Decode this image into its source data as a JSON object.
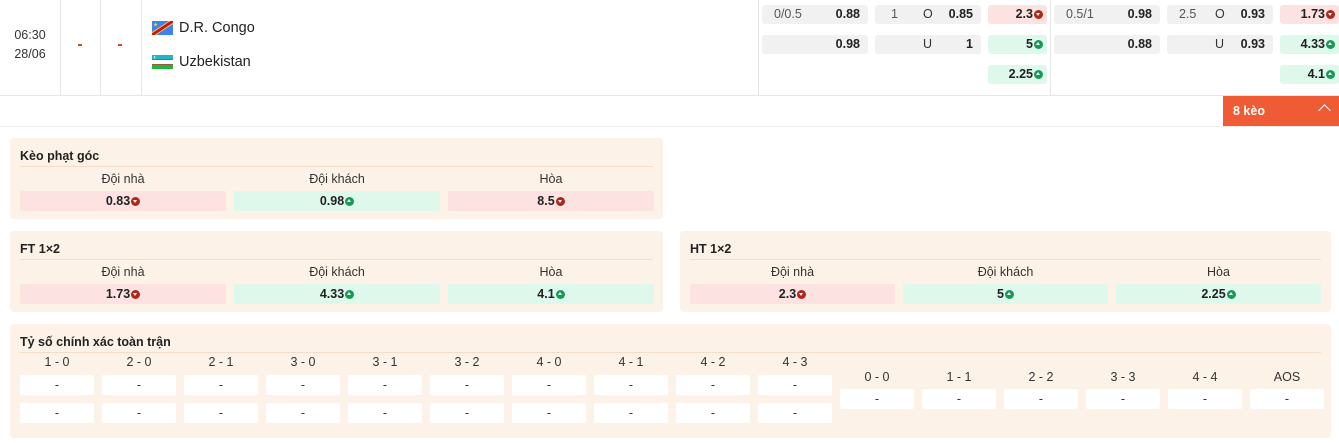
{
  "match": {
    "time": "06:30",
    "date": "28/06",
    "home_score": "-",
    "away_score": "-",
    "home_team": "D.R. Congo",
    "away_team": "Uzbekistan"
  },
  "odds": {
    "hdp_ft": {
      "line": "0/0.5",
      "home": "0.88",
      "away": "0.98"
    },
    "ou_ft": {
      "line": "1",
      "over_label": "O",
      "over": "0.85",
      "under_label": "U",
      "under": "1"
    },
    "x12_ft": {
      "home": "2.3",
      "away": "5",
      "draw": "2.25"
    },
    "hdp_ht": {
      "line": "0.5/1",
      "home": "0.98",
      "away": "0.88"
    },
    "ou_ht": {
      "line": "2.5",
      "over_label": "O",
      "over": "0.93",
      "under_label": "U",
      "under": "0.93"
    },
    "x12_ht": {
      "home": "1.73",
      "away": "4.33",
      "draw": "4.1"
    }
  },
  "more_button": "8 kèo",
  "corners": {
    "title": "Kèo phạt góc",
    "headers": [
      "Đội nhà",
      "Đội khách",
      "Hòa"
    ],
    "values": [
      "0.83",
      "0.98",
      "8.5"
    ]
  },
  "ft_1x2": {
    "title": "FT 1×2",
    "headers": [
      "Đội nhà",
      "Đội khách",
      "Hòa"
    ],
    "values": [
      "1.73",
      "4.33",
      "4.1"
    ]
  },
  "ht_1x2": {
    "title": "HT 1×2",
    "headers": [
      "Đội nhà",
      "Đội khách",
      "Hòa"
    ],
    "values": [
      "2.3",
      "5",
      "2.25"
    ]
  },
  "correct_score": {
    "title": "Tỷ số chính xác toàn trận",
    "home_win": [
      {
        "score": "1 - 0",
        "a": "-",
        "b": "-"
      },
      {
        "score": "2 - 0",
        "a": "-",
        "b": "-"
      },
      {
        "score": "2 - 1",
        "a": "-",
        "b": "-"
      },
      {
        "score": "3 - 0",
        "a": "-",
        "b": "-"
      },
      {
        "score": "3 - 1",
        "a": "-",
        "b": "-"
      },
      {
        "score": "3 - 2",
        "a": "-",
        "b": "-"
      },
      {
        "score": "4 - 0",
        "a": "-",
        "b": "-"
      },
      {
        "score": "4 - 1",
        "a": "-",
        "b": "-"
      },
      {
        "score": "4 - 2",
        "a": "-",
        "b": "-"
      },
      {
        "score": "4 - 3",
        "a": "-",
        "b": "-"
      }
    ],
    "draws": [
      {
        "score": "0 - 0",
        "v": "-"
      },
      {
        "score": "1 - 1",
        "v": "-"
      },
      {
        "score": "2 - 2",
        "v": "-"
      },
      {
        "score": "3 - 3",
        "v": "-"
      },
      {
        "score": "4 - 4",
        "v": "-"
      },
      {
        "score": "AOS",
        "v": "-"
      }
    ]
  },
  "colors": {
    "accent": "#ee5b34",
    "down": "#b0261a",
    "up": "#159a58",
    "panel_bg": "#fdf2e7"
  }
}
